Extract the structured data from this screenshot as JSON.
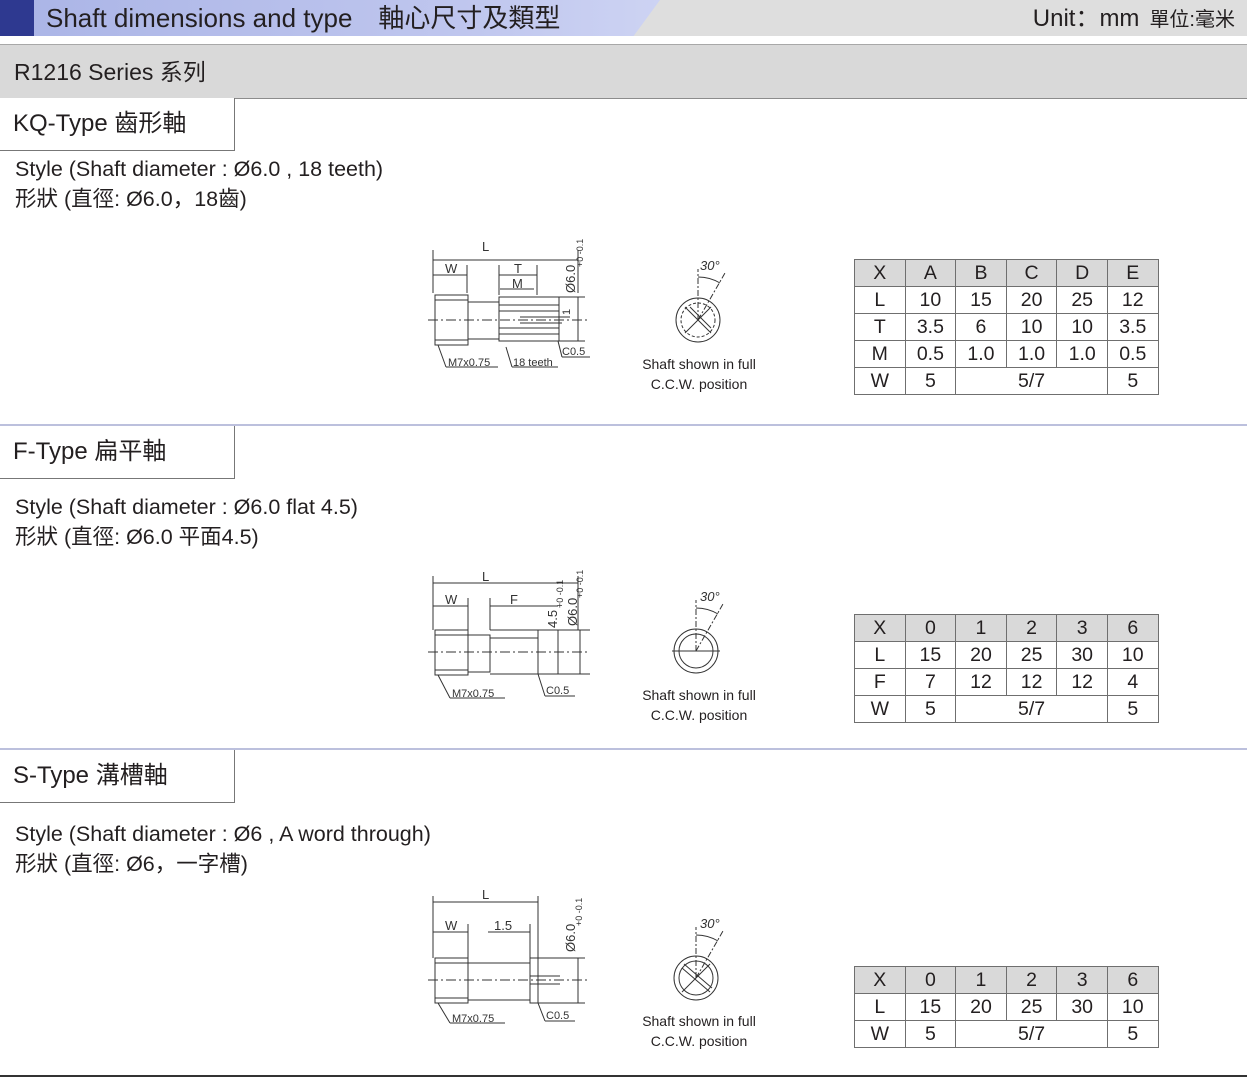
{
  "header": {
    "title": "Shaft dimensions and type　軸心尺寸及類型",
    "unit": "Unit：mm",
    "unit_cn": "單位:毫米"
  },
  "series": {
    "title": "R1216 Series 系列"
  },
  "sections": [
    {
      "tab": "KQ-Type  齒形軸",
      "style_en": "Style (Shaft diameter : Ø6.0 , 18 teeth)",
      "style_cn": "形狀 (直徑: Ø6.0，18齒)",
      "drawing_labels": {
        "L": "L",
        "W": "W",
        "T": "T",
        "M": "M",
        "dia": "Ø6.0",
        "tol": "+0 -0.1",
        "one": "1",
        "thread": "M7x0.75",
        "teeth": "18 teeth",
        "chamfer": "C0.5"
      },
      "angle": "30°",
      "caption1": "Shaft shown in full",
      "caption2": "C.C.W. position",
      "table": [
        [
          "X",
          "A",
          "B",
          "C",
          "D",
          "E"
        ],
        [
          "L",
          "10",
          "15",
          "20",
          "25",
          "12"
        ],
        [
          "T",
          "3.5",
          "6",
          "10",
          "10",
          "3.5"
        ],
        [
          "M",
          "0.5",
          "1.0",
          "1.0",
          "1.0",
          "0.5"
        ],
        [
          "W",
          "5",
          "5/7",
          "5"
        ]
      ]
    },
    {
      "tab": "F-Type  扁平軸",
      "style_en": "Style (Shaft diameter : Ø6.0   flat 4.5)",
      "style_cn": "形狀 (直徑: Ø6.0 平面4.5)",
      "drawing_labels": {
        "L": "L",
        "W": "W",
        "F": "F",
        "flat": "4.5",
        "flat_tol": "+0 -0.1",
        "dia": "Ø6.0",
        "tol": "+0 -0.1",
        "thread": "M7x0.75",
        "chamfer": "C0.5"
      },
      "angle": "30°",
      "caption1": "Shaft shown in full",
      "caption2": "C.C.W. position",
      "table": [
        [
          "X",
          "0",
          "1",
          "2",
          "3",
          "6"
        ],
        [
          "L",
          "15",
          "20",
          "25",
          "30",
          "10"
        ],
        [
          "F",
          "7",
          "12",
          "12",
          "12",
          "4"
        ],
        [
          "W",
          "5",
          "5/7",
          "5"
        ]
      ]
    },
    {
      "tab": "S-Type  溝槽軸",
      "style_en": "Style (Shaft diameter : Ø6 , A word through)",
      "style_cn": "形狀 (直徑: Ø6，一字槽)",
      "drawing_labels": {
        "L": "L",
        "W": "W",
        "slot": "1.5",
        "dia": "Ø6.0",
        "tol": "+0 -0.1",
        "thread": "M7x0.75",
        "chamfer": "C0.5"
      },
      "angle": "30°",
      "caption1": "Shaft shown in full",
      "caption2": "C.C.W. position",
      "table": [
        [
          "X",
          "0",
          "1",
          "2",
          "3",
          "6"
        ],
        [
          "L",
          "15",
          "20",
          "25",
          "30",
          "10"
        ],
        [
          "W",
          "5",
          "5/7",
          "5"
        ]
      ]
    }
  ]
}
